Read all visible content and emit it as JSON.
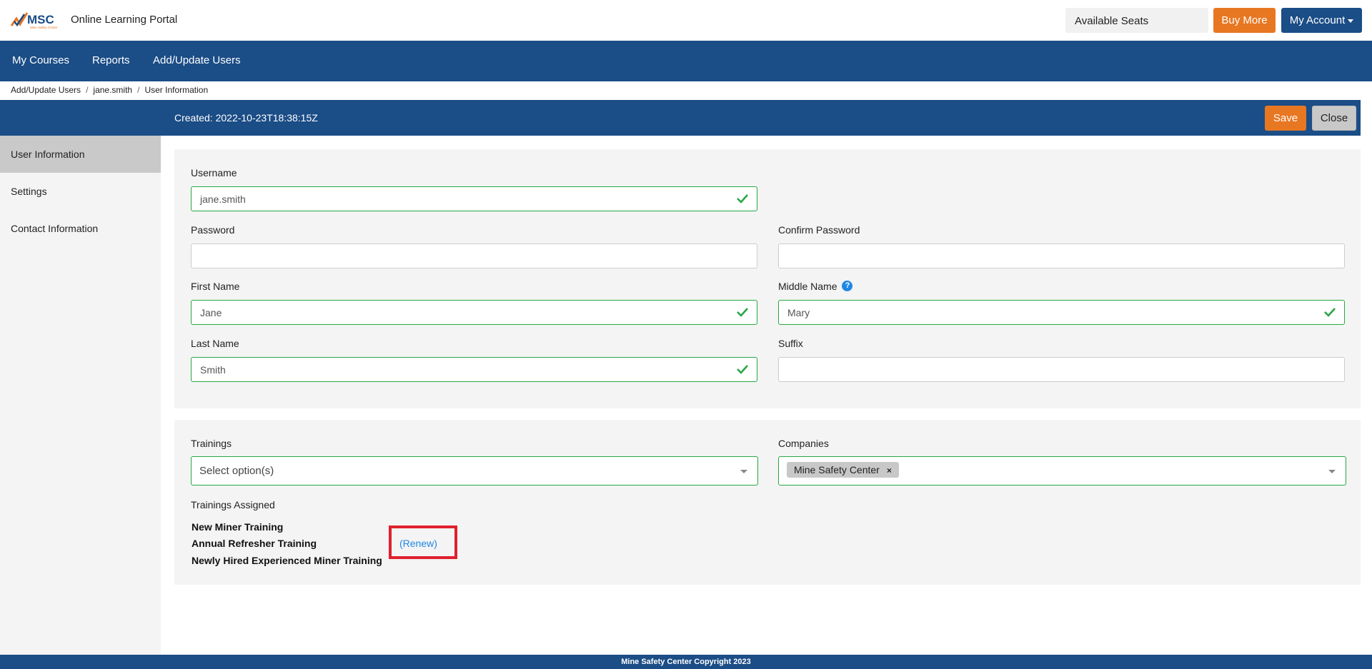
{
  "header": {
    "logo_text": "MSC",
    "logo_subtext": "Mine Safety Center",
    "portal_title": "Online Learning Portal",
    "available_seats_label": "Available Seats",
    "buy_more_label": "Buy More",
    "my_account_label": "My Account"
  },
  "nav": {
    "items": [
      {
        "label": "My Courses"
      },
      {
        "label": "Reports"
      },
      {
        "label": "Add/Update Users"
      }
    ]
  },
  "breadcrumb": {
    "items": [
      {
        "label": "Add/Update Users"
      },
      {
        "label": "jane.smith"
      },
      {
        "label": "User Information"
      }
    ],
    "separator": "/"
  },
  "subheader": {
    "created_text": "Created: 2022-10-23T18:38:15Z",
    "save_label": "Save",
    "close_label": "Close"
  },
  "sidebar": {
    "items": [
      {
        "label": "User Information",
        "active": true
      },
      {
        "label": "Settings",
        "active": false
      },
      {
        "label": "Contact Information",
        "active": false
      }
    ]
  },
  "form": {
    "username_label": "Username",
    "username_value": "jane.smith",
    "password_label": "Password",
    "password_value": "",
    "confirm_password_label": "Confirm Password",
    "confirm_password_value": "",
    "first_name_label": "First Name",
    "first_name_value": "Jane",
    "middle_name_label": "Middle Name",
    "middle_name_help": "?",
    "middle_name_value": "Mary",
    "last_name_label": "Last Name",
    "last_name_value": "Smith",
    "suffix_label": "Suffix",
    "suffix_value": ""
  },
  "assignments": {
    "trainings_label": "Trainings",
    "trainings_placeholder": "Select option(s)",
    "companies_label": "Companies",
    "companies_selected": "Mine Safety Center",
    "tag_remove": "×",
    "trainings_assigned_label": "Trainings Assigned",
    "assigned": [
      {
        "name": "New Miner Training"
      },
      {
        "name": "Annual Refresher Training"
      },
      {
        "name": "Newly Hired Experienced Miner Training"
      }
    ],
    "renew_label": "(Renew)"
  },
  "footer": {
    "text": "Mine Safety Center Copyright 2023"
  },
  "colors": {
    "primary": "#1b4d86",
    "accent": "#e87722",
    "valid": "#28a745",
    "link": "#1e88e5",
    "highlight": "#e0202e"
  }
}
